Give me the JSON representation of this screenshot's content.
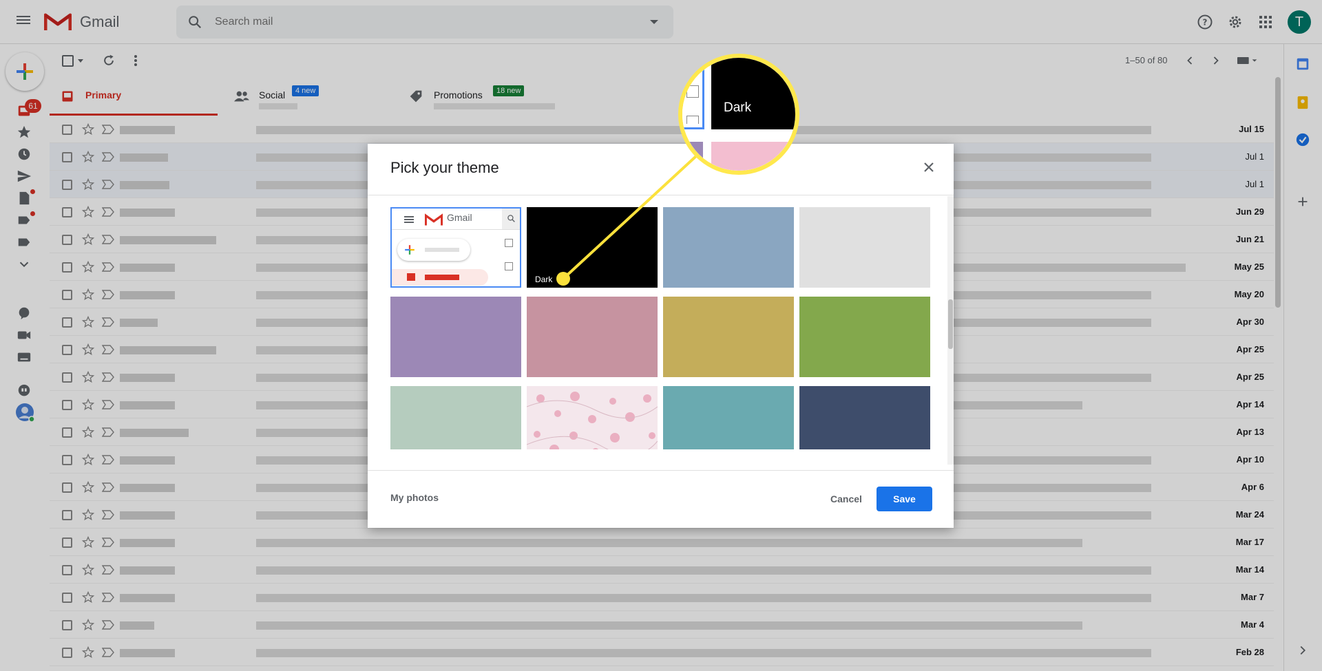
{
  "app": {
    "name": "Gmail"
  },
  "search": {
    "placeholder": "Search mail"
  },
  "account": {
    "initial": "T"
  },
  "rail": {
    "inbox_badge": "61"
  },
  "pager": {
    "text": "1–50 of 80"
  },
  "tabs": [
    {
      "label": "Primary"
    },
    {
      "label": "Social",
      "badge": "4 new"
    },
    {
      "label": "Promotions",
      "badge": "18 new"
    }
  ],
  "mail_dates": [
    "Jul 15",
    "Jul 1",
    "Jul 1",
    "Jun 29",
    "Jun 21",
    "May 25",
    "May 20",
    "Apr 30",
    "Apr 25",
    "Apr 25",
    "Apr 14",
    "Apr 13",
    "Apr 10",
    "Apr 6",
    "Mar 24",
    "Mar 17",
    "Mar 14",
    "Mar 7",
    "Mar 4",
    "Feb 28"
  ],
  "dialog": {
    "title": "Pick your theme",
    "dark_label": "Dark",
    "my_photos": "My photos",
    "cancel": "Cancel",
    "save": "Save",
    "theme_colors": {
      "dark": "#000000",
      "blue": "#8aa6c1",
      "light_gray": "#e0e0e0",
      "purple": "#9c88b6",
      "pink": "#c693a0",
      "mustard": "#c4ad5a",
      "green": "#83a84c",
      "sage": "#b5ccbe",
      "teal": "#6aaab0",
      "navy": "#3e4d6b"
    }
  },
  "magnifier": {
    "label": "Dark"
  },
  "colors": {
    "accent": "#d93025",
    "primary_button": "#1a73e8",
    "callout": "#ffe84d"
  }
}
